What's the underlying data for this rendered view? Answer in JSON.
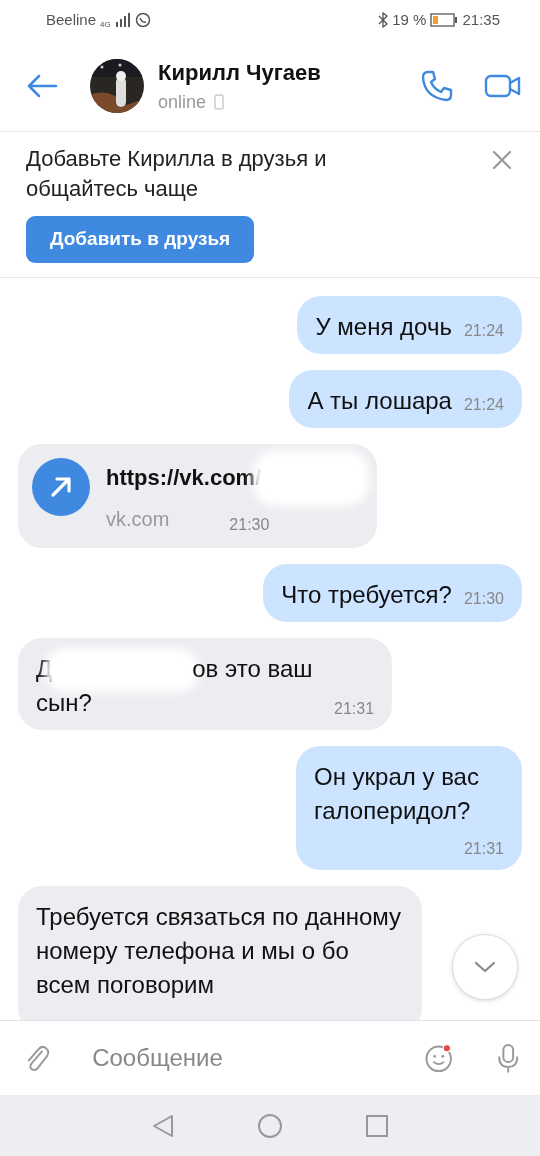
{
  "status_bar": {
    "carrier": "Beeline",
    "network": "4G",
    "battery": "19 %",
    "time": "21:35"
  },
  "header": {
    "name": "Кирилл Чугаев",
    "status": "online"
  },
  "banner": {
    "text": "Добавьте Кирилла в друзья и общайтесь чаще",
    "button": "Добавить в друзья"
  },
  "messages": [
    {
      "kind": "text",
      "outgoing": true,
      "text": "У меня дочь",
      "time": "21:24"
    },
    {
      "kind": "text",
      "outgoing": true,
      "text": "А ты лошара",
      "time": "21:24"
    },
    {
      "kind": "link",
      "outgoing": false,
      "url": "https://vk.com/",
      "domain": "vk.com",
      "time": "21:30"
    },
    {
      "kind": "text",
      "outgoing": true,
      "text": "Что требуется?",
      "time": "21:30"
    },
    {
      "kind": "redacted",
      "outgoing": false,
      "before": "Д",
      "after": "ов это ваш сын?",
      "time": "21:31"
    },
    {
      "kind": "text",
      "outgoing": true,
      "text": "Он украл у вас галоперидол?",
      "time": "21:31"
    },
    {
      "kind": "text",
      "outgoing": false,
      "text": "Требуется связаться по данному номеру телефона и мы о бо всем поговорим"
    }
  ],
  "composer": {
    "placeholder": "Сообщение"
  }
}
